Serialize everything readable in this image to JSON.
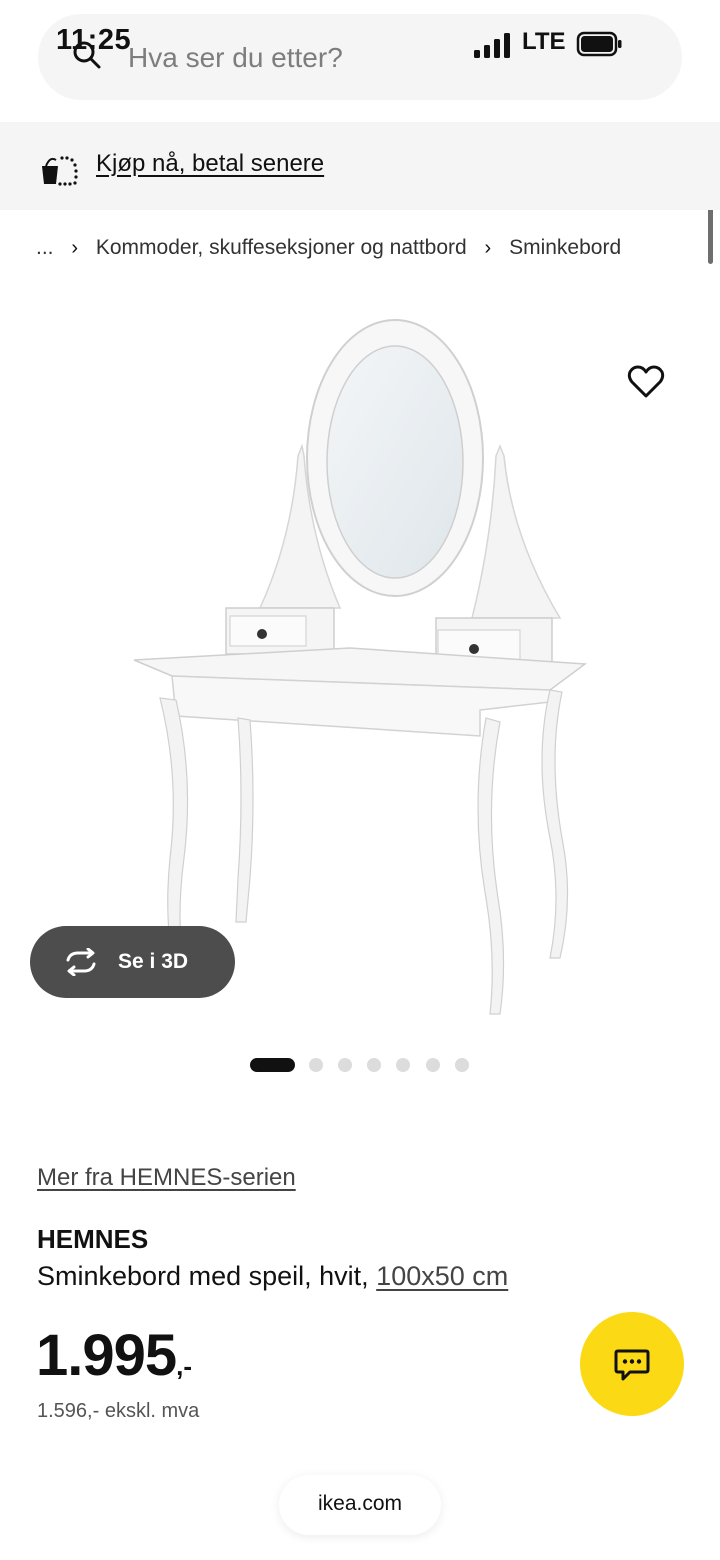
{
  "status_bar": {
    "time": "11:25",
    "network": "LTE",
    "icons": [
      "signal-icon",
      "battery-icon"
    ]
  },
  "search": {
    "placeholder": "Hva ser du etter?",
    "icon": "search-icon"
  },
  "bnpl_banner": {
    "label": "Kjøp nå, betal senere",
    "icon": "bnpl-icon"
  },
  "breadcrumb": {
    "ellipsis": "...",
    "items": [
      "Kommoder, skuffeseksjoner og nattbord",
      "Sminkebord"
    ],
    "separator": "›"
  },
  "media": {
    "view_3d_label": "Se i 3D",
    "carousel": {
      "total": 7,
      "active_index": 0
    },
    "favorite_icon": "heart-icon"
  },
  "product": {
    "series_link": "Mer fra HEMNES-serien",
    "name": "HEMNES",
    "description": "Sminkebord med speil, hvit,",
    "dimensions": "100x50 cm",
    "price_main": "1.995",
    "price_suffix": ",-",
    "price_ex_vat": "1.596,- ekskl. mva"
  },
  "chat": {
    "icon": "chat-icon"
  },
  "browser": {
    "url": "ikea.com"
  },
  "colors": {
    "chat_button": "#fbd914",
    "view_3d_button": "#4d4d4d",
    "banner": "#f5f5f5"
  }
}
